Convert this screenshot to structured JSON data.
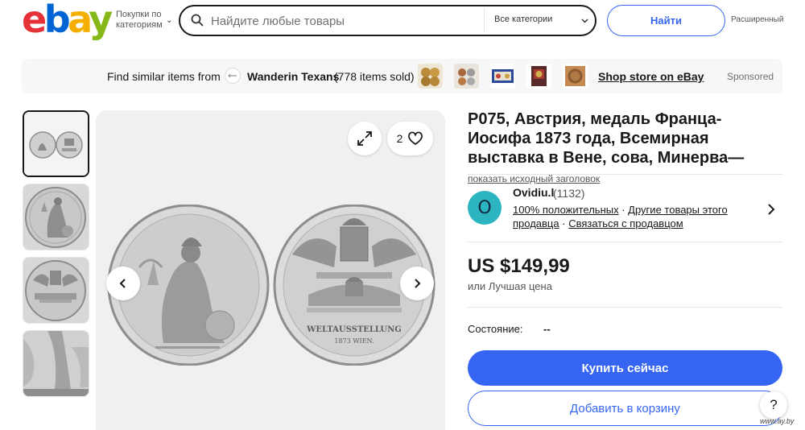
{
  "header": {
    "logo": [
      "e",
      "b",
      "a",
      "y"
    ],
    "shop_by_category": "Покупки по категориям",
    "search_placeholder": "Найдите любые товары",
    "category_select": "Все категории",
    "search_button": "Найти",
    "advanced": "Расширенный"
  },
  "banner": {
    "find_similar": "Find similar items from",
    "store_name": "Wanderin Texans",
    "items_sold": "(778 items sold)",
    "shop_store": "Shop store on eBay",
    "sponsored": "Sponsored"
  },
  "gallery": {
    "watch_count": "2"
  },
  "listing": {
    "title": "P075, Австрия, медаль Франца-Иосифа 1873 года, Всемирная выставка в Вене, сова, Минерва—",
    "show_original_title": "показать исходный заголовок",
    "price": "US $149,99",
    "best_offer": "или Лучшая цена",
    "condition_label": "Состояние:",
    "condition_value": "--",
    "buy_now": "Купить сейчас",
    "add_to_cart": "Добавить в корзину"
  },
  "seller": {
    "avatar_letter": "O",
    "name": "Ovidiu.l",
    "feedback_count": "(1132)",
    "positive": "100% положительных",
    "other_items": "Другие товары этого продавца",
    "contact": "Связаться с продавцом"
  },
  "help": "?",
  "watermark": "www.ay.by",
  "colors": {
    "primary_blue": "#3665f3",
    "logo_red": "#e53238",
    "logo_blue": "#0064d2",
    "logo_yellow": "#f5af02",
    "logo_green": "#86b817",
    "avatar_teal": "#2cb5c0"
  }
}
